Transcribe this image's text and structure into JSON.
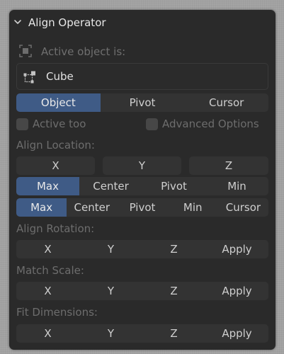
{
  "panel": {
    "title": "Align Operator"
  },
  "active_object_label": "Active object is:",
  "object_field": {
    "value": "Cube"
  },
  "target_tabs": [
    {
      "label": "Object",
      "active": true
    },
    {
      "label": "Pivot",
      "active": false
    },
    {
      "label": "Cursor",
      "active": false
    }
  ],
  "checkboxes": {
    "active_too": {
      "label": "Active too",
      "checked": false
    },
    "advanced": {
      "label": "Advanced Options",
      "checked": false
    }
  },
  "align_location": {
    "label": "Align Location:",
    "axes": [
      "X",
      "Y",
      "Z"
    ],
    "source_modes": [
      {
        "label": "Max",
        "active": true
      },
      {
        "label": "Center",
        "active": false
      },
      {
        "label": "Pivot",
        "active": false
      },
      {
        "label": "Min",
        "active": false
      }
    ],
    "target_modes": [
      {
        "label": "Max",
        "active": true
      },
      {
        "label": "Center",
        "active": false
      },
      {
        "label": "Pivot",
        "active": false
      },
      {
        "label": "Min",
        "active": false
      },
      {
        "label": "Cursor",
        "active": false
      }
    ]
  },
  "align_rotation": {
    "label": "Align Rotation:",
    "items": [
      "X",
      "Y",
      "Z",
      "Apply"
    ]
  },
  "match_scale": {
    "label": "Match Scale:",
    "items": [
      "X",
      "Y",
      "Z",
      "Apply"
    ]
  },
  "fit_dimensions": {
    "label": "Fit Dimensions:",
    "items": [
      "X",
      "Y",
      "Z",
      "Apply"
    ]
  },
  "colors": {
    "panel_bg": "#2a2a2a",
    "active_blue": "#3f5b86",
    "button_bg": "#333333"
  },
  "icons": {
    "header": "chevron-down-icon",
    "active_object": "object-origin-icon",
    "object_field": "mesh-object-icon"
  }
}
